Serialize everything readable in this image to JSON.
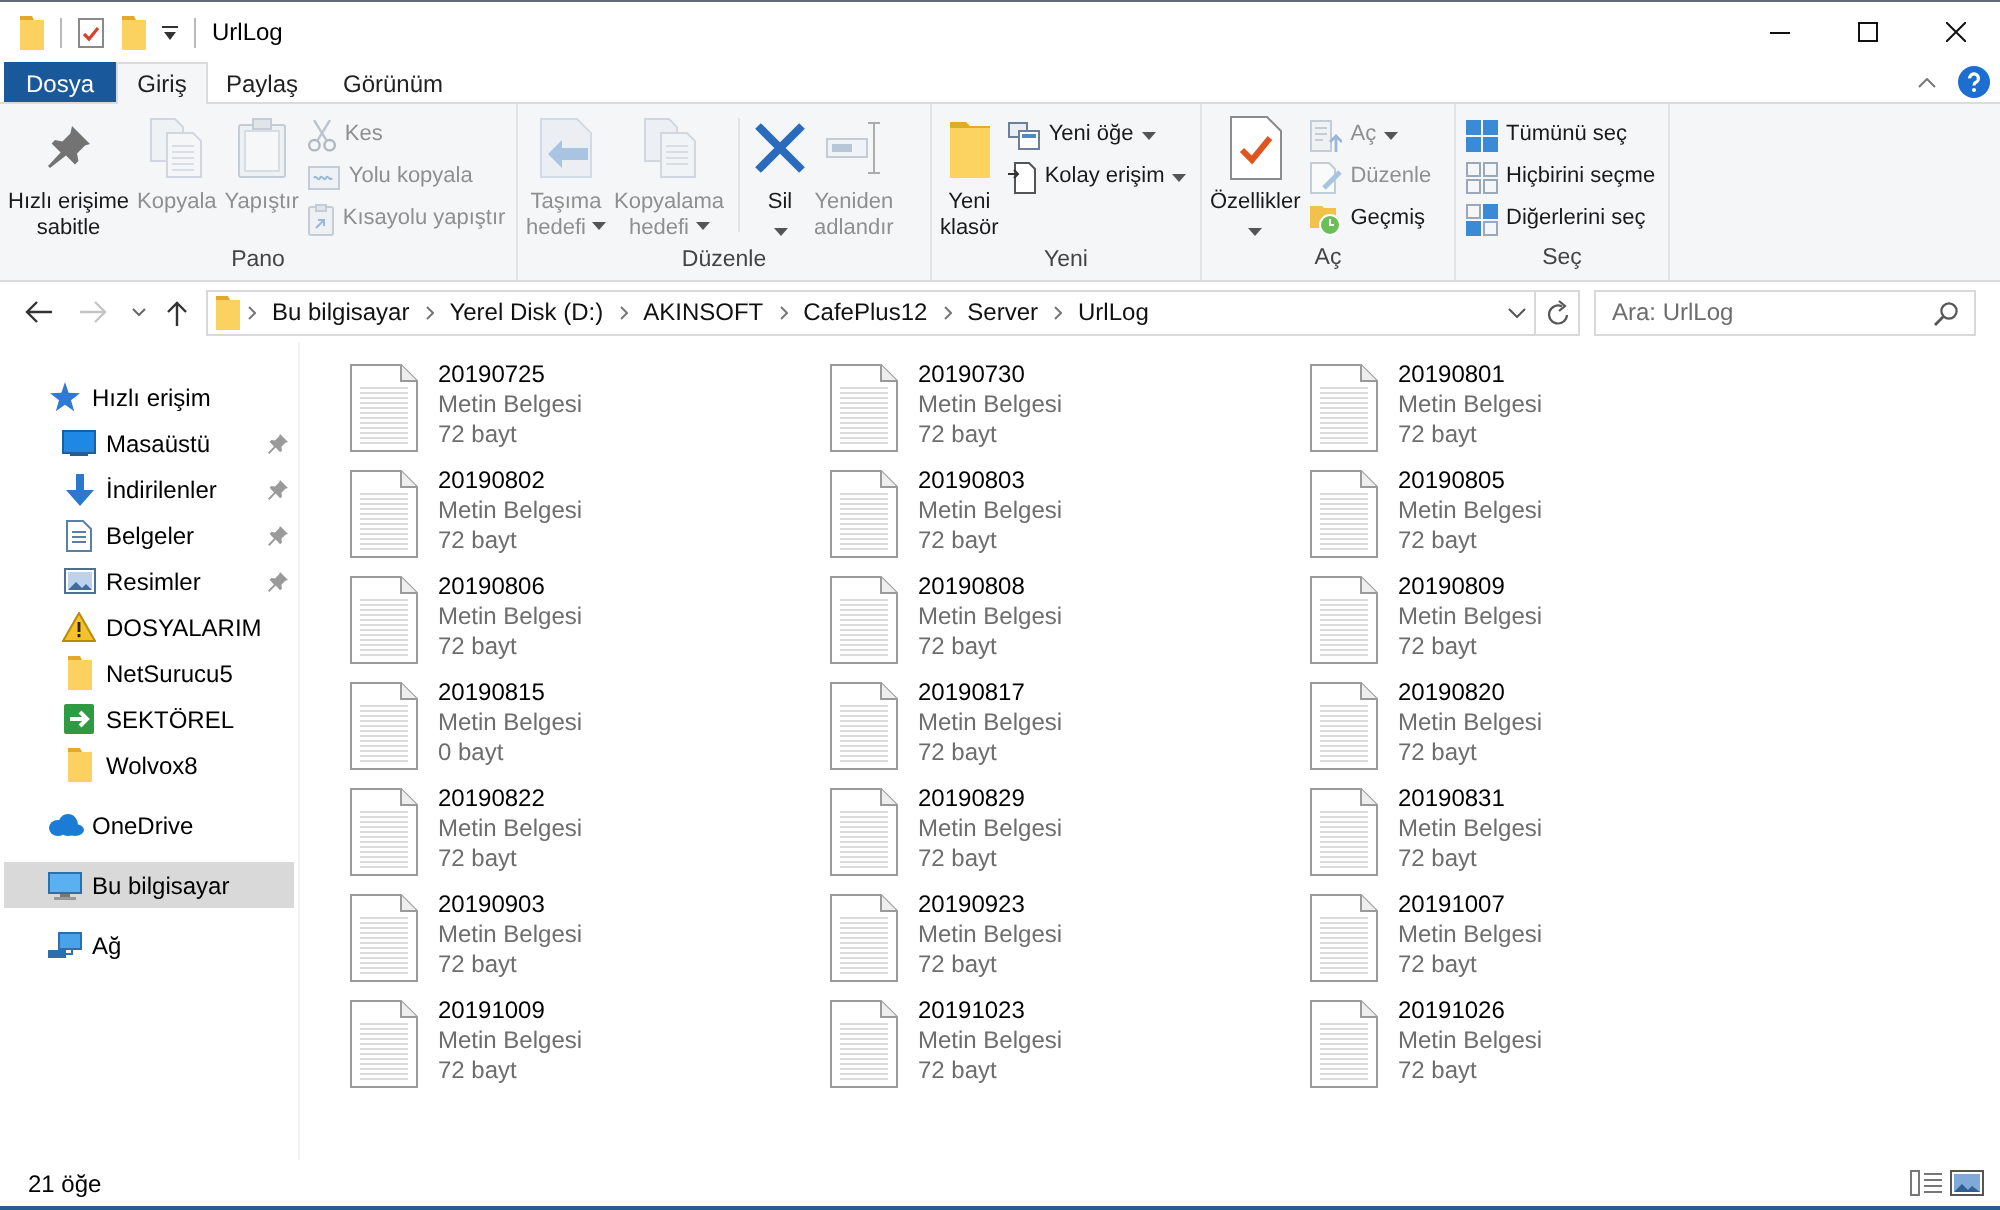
{
  "window": {
    "title": "UrlLog"
  },
  "ribbon": {
    "tabs": [
      {
        "label": "Dosya",
        "kind": "file",
        "selected": false
      },
      {
        "label": "Giriş",
        "kind": "tab",
        "selected": true
      },
      {
        "label": "Paylaş",
        "kind": "tab",
        "selected": false
      },
      {
        "label": "Görünüm",
        "kind": "tab",
        "selected": false
      }
    ],
    "groups": [
      {
        "label": "Pano",
        "sections": [
          [
            {
              "label": "Hızlı erişime\nsabitle",
              "kind": "large",
              "disabled": false,
              "dropdown": false
            },
            {
              "label": "Kopyala",
              "kind": "large",
              "disabled": true,
              "dropdown": false
            },
            {
              "label": "Yapıştır",
              "kind": "large",
              "disabled": true,
              "dropdown": false
            },
            {
              "label": "Kes",
              "kind": "small",
              "disabled": true,
              "dropdown": false
            },
            {
              "label": "Yolu kopyala",
              "kind": "small",
              "disabled": true,
              "dropdown": false
            },
            {
              "label": "Kısayolu yapıştır",
              "kind": "small",
              "disabled": true,
              "dropdown": false
            }
          ]
        ]
      },
      {
        "label": "Düzenle",
        "sections": [
          [
            {
              "label": "Taşıma\nhedefi",
              "kind": "large",
              "disabled": true,
              "dropdown": true
            },
            {
              "label": "Kopyalama\nhedefi",
              "kind": "large",
              "disabled": true,
              "dropdown": true
            }
          ],
          [
            {
              "label": "Sil",
              "kind": "split",
              "disabled": false,
              "dropdown": true
            },
            {
              "label": "Yeniden\nadlandır",
              "kind": "large",
              "disabled": true,
              "dropdown": false
            }
          ]
        ]
      },
      {
        "label": "Yeni",
        "sections": [
          [
            {
              "label": "Yeni\nklasör",
              "kind": "large",
              "disabled": false,
              "dropdown": false
            },
            {
              "label": "Yeni öğe",
              "kind": "small",
              "disabled": false,
              "dropdown": true
            },
            {
              "label": "Kolay erişim",
              "kind": "small",
              "disabled": false,
              "dropdown": true
            }
          ]
        ]
      },
      {
        "label": "Aç",
        "sections": [
          [
            {
              "label": "Özellikler",
              "kind": "split",
              "disabled": false,
              "dropdown": true
            },
            {
              "label": "Aç",
              "kind": "small",
              "disabled": true,
              "dropdown": true
            },
            {
              "label": "Düzenle",
              "kind": "small",
              "disabled": true,
              "dropdown": false
            },
            {
              "label": "Geçmiş",
              "kind": "small",
              "disabled": false,
              "dropdown": false
            }
          ]
        ]
      },
      {
        "label": "Seç",
        "sections": [
          [
            {
              "label": "Tümünü seç",
              "kind": "small",
              "disabled": false,
              "dropdown": false
            },
            {
              "label": "Hiçbirini seçme",
              "kind": "small",
              "disabled": false,
              "dropdown": false
            },
            {
              "label": "Diğerlerini seç",
              "kind": "small",
              "disabled": false,
              "dropdown": false
            }
          ]
        ]
      }
    ]
  },
  "address_bar": {
    "crumbs": [
      "Bu bilgisayar",
      "Yerel Disk (D:)",
      "AKINSOFT",
      "CafePlus12",
      "Server",
      "UrlLog"
    ]
  },
  "search": {
    "placeholder": "Ara: UrlLog"
  },
  "nav_pane": {
    "items": [
      {
        "label": "Hızlı erişim",
        "kind": "quick_access",
        "selected": false,
        "children": [
          {
            "label": "Masaüstü",
            "kind": "desktop",
            "pinned": true,
            "selected": false
          },
          {
            "label": "İndirilenler",
            "kind": "downloads",
            "pinned": true,
            "selected": false
          },
          {
            "label": "Belgeler",
            "kind": "documents",
            "pinned": true,
            "selected": false
          },
          {
            "label": "Resimler",
            "kind": "pictures",
            "pinned": true,
            "selected": false
          },
          {
            "label": "DOSYALARIM",
            "kind": "folder_alert",
            "pinned": false,
            "selected": false
          },
          {
            "label": "NetSurucu5",
            "kind": "folder",
            "pinned": false,
            "selected": false
          },
          {
            "label": "SEKTÖREL",
            "kind": "shortcut",
            "pinned": false,
            "selected": false
          },
          {
            "label": "Wolvox8",
            "kind": "folder",
            "pinned": false,
            "selected": false
          }
        ]
      },
      {
        "label": "OneDrive",
        "kind": "cloud",
        "selected": false
      },
      {
        "label": "Bu bilgisayar",
        "kind": "computer",
        "selected": true
      },
      {
        "label": "Ağ",
        "kind": "network",
        "selected": false
      }
    ]
  },
  "files": [
    {
      "name": "20190725",
      "type": "Metin Belgesi",
      "size": "72 bayt"
    },
    {
      "name": "20190730",
      "type": "Metin Belgesi",
      "size": "72 bayt"
    },
    {
      "name": "20190801",
      "type": "Metin Belgesi",
      "size": "72 bayt"
    },
    {
      "name": "20190802",
      "type": "Metin Belgesi",
      "size": "72 bayt"
    },
    {
      "name": "20190803",
      "type": "Metin Belgesi",
      "size": "72 bayt"
    },
    {
      "name": "20190805",
      "type": "Metin Belgesi",
      "size": "72 bayt"
    },
    {
      "name": "20190806",
      "type": "Metin Belgesi",
      "size": "72 bayt"
    },
    {
      "name": "20190808",
      "type": "Metin Belgesi",
      "size": "72 bayt"
    },
    {
      "name": "20190809",
      "type": "Metin Belgesi",
      "size": "72 bayt"
    },
    {
      "name": "20190815",
      "type": "Metin Belgesi",
      "size": "0 bayt"
    },
    {
      "name": "20190817",
      "type": "Metin Belgesi",
      "size": "72 bayt"
    },
    {
      "name": "20190820",
      "type": "Metin Belgesi",
      "size": "72 bayt"
    },
    {
      "name": "20190822",
      "type": "Metin Belgesi",
      "size": "72 bayt"
    },
    {
      "name": "20190829",
      "type": "Metin Belgesi",
      "size": "72 bayt"
    },
    {
      "name": "20190831",
      "type": "Metin Belgesi",
      "size": "72 bayt"
    },
    {
      "name": "20190903",
      "type": "Metin Belgesi",
      "size": "72 bayt"
    },
    {
      "name": "20190923",
      "type": "Metin Belgesi",
      "size": "72 bayt"
    },
    {
      "name": "20191007",
      "type": "Metin Belgesi",
      "size": "72 bayt"
    },
    {
      "name": "20191009",
      "type": "Metin Belgesi",
      "size": "72 bayt"
    },
    {
      "name": "20191023",
      "type": "Metin Belgesi",
      "size": "72 bayt"
    },
    {
      "name": "20191026",
      "type": "Metin Belgesi",
      "size": "72 bayt"
    }
  ],
  "status_bar": {
    "item_count": "21 öğe"
  }
}
